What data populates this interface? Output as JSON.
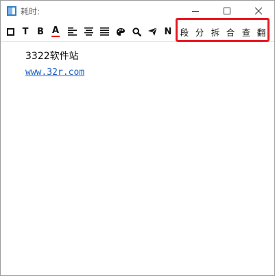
{
  "window": {
    "title": "耗时:"
  },
  "toolbar": {
    "items": [
      {
        "name": "box-icon",
        "glyph": ""
      },
      {
        "name": "text-icon",
        "glyph": "T"
      },
      {
        "name": "bold-icon",
        "glyph": "B"
      },
      {
        "name": "font-color-icon",
        "glyph": "A"
      },
      {
        "name": "align-left-icon",
        "glyph": ""
      },
      {
        "name": "align-center-icon",
        "glyph": ""
      },
      {
        "name": "align-justify-icon",
        "glyph": ""
      },
      {
        "name": "palette-icon",
        "glyph": ""
      },
      {
        "name": "search-icon",
        "glyph": ""
      },
      {
        "name": "send-icon",
        "glyph": ""
      },
      {
        "name": "n-icon",
        "glyph": "N"
      }
    ],
    "cn_buttons": [
      "段",
      "分",
      "拆",
      "合",
      "查",
      "翻"
    ],
    "accent_color": "#e8181f"
  },
  "content": {
    "line1": "3322软件站",
    "link": "www.32r.com"
  }
}
